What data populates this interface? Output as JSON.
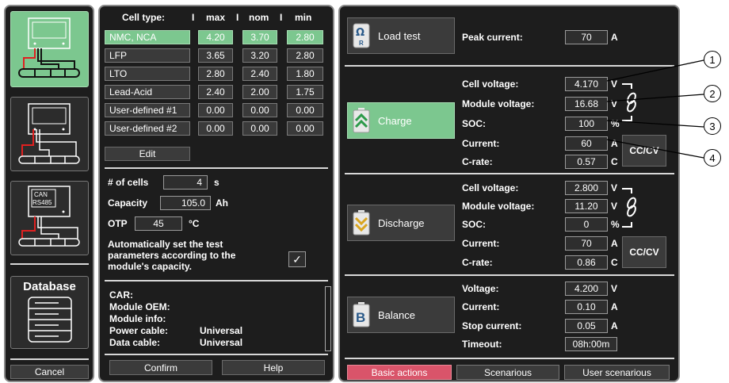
{
  "sidebar": {
    "database_label": "Database",
    "can_label": "CAN",
    "rs485_label": "RS485",
    "cancel_label": "Cancel"
  },
  "cells": {
    "headers": [
      "Cell type:",
      "max",
      "nom",
      "min"
    ],
    "rows": [
      {
        "name": "NMC, NCA",
        "max": "4.20",
        "nom": "3.70",
        "min": "2.80",
        "selected": true
      },
      {
        "name": "LFP",
        "max": "3.65",
        "nom": "3.20",
        "min": "2.80"
      },
      {
        "name": "LTO",
        "max": "2.80",
        "nom": "2.40",
        "min": "1.80"
      },
      {
        "name": "Lead-Acid",
        "max": "2.40",
        "nom": "2.00",
        "min": "1.75"
      },
      {
        "name": "User-defined #1",
        "max": "0.00",
        "nom": "0.00",
        "min": "0.00"
      },
      {
        "name": "User-defined #2",
        "max": "0.00",
        "nom": "0.00",
        "min": "0.00"
      }
    ],
    "edit_label": "Edit"
  },
  "module": {
    "cells_label": "# of cells",
    "cells_value": "4",
    "cells_unit": "s",
    "capacity_label": "Capacity",
    "capacity_value": "105.0",
    "capacity_unit": "Ah",
    "otp_label": "OTP",
    "otp_value": "45",
    "otp_unit": "°C",
    "auto_text": "Automatically set the test parameters according to the module's capacity.",
    "auto_checked": "✓"
  },
  "info": {
    "car": "CAR:",
    "oem": "Module OEM:",
    "info": "Module info:",
    "power_label": "Power cable:",
    "power_value": "Universal",
    "data_label": "Data cable:",
    "data_value": "Universal"
  },
  "footer_mid": {
    "confirm": "Confirm",
    "help": "Help"
  },
  "load_test": {
    "label": "Load test",
    "peak_label": "Peak current:",
    "peak_value": "70",
    "peak_unit": "A"
  },
  "charge": {
    "label": "Charge",
    "cell_voltage_label": "Cell voltage:",
    "cell_voltage": "4.170",
    "cell_voltage_unit": "V",
    "module_voltage_label": "Module voltage:",
    "module_voltage": "16.68",
    "module_voltage_unit": "V",
    "soc_label": "SOC:",
    "soc": "100",
    "soc_unit": "%",
    "current_label": "Current:",
    "current": "60",
    "current_unit": "A",
    "crate_label": "C-rate:",
    "crate": "0.57",
    "crate_unit": "C",
    "cccv": "CC/CV"
  },
  "discharge": {
    "label": "Discharge",
    "cell_voltage_label": "Cell voltage:",
    "cell_voltage": "2.800",
    "cell_voltage_unit": "V",
    "module_voltage_label": "Module voltage:",
    "module_voltage": "11.20",
    "module_voltage_unit": "V",
    "soc_label": "SOC:",
    "soc": "0",
    "soc_unit": "%",
    "current_label": "Current:",
    "current": "70",
    "current_unit": "A",
    "crate_label": "C-rate:",
    "crate": "0.86",
    "crate_unit": "C",
    "cccv": "CC/CV"
  },
  "balance": {
    "label": "Balance",
    "voltage_label": "Voltage:",
    "voltage": "4.200",
    "voltage_unit": "V",
    "current_label": "Current:",
    "current": "0.10",
    "current_unit": "A",
    "stop_label": "Stop current:",
    "stop": "0.05",
    "stop_unit": "A",
    "timeout_label": "Timeout:",
    "timeout": "08h:00m"
  },
  "tabs": [
    "Basic actions",
    "Scenarious",
    "User scenarious"
  ],
  "callouts": [
    "1",
    "2",
    "3",
    "4"
  ],
  "colors": {
    "accent_green": "#7cc78f",
    "active_tab": "#d9546a",
    "panel": "#1d1d1d"
  }
}
